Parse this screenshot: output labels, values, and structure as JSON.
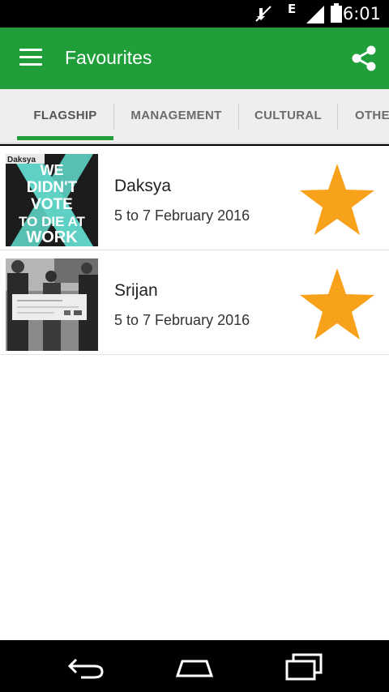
{
  "status_bar": {
    "time": "6:01",
    "network_type": "E",
    "icons": [
      "mute-icon",
      "signal-icon",
      "battery-icon"
    ]
  },
  "app_bar": {
    "title": "Favourites",
    "color": "#1f9e3a",
    "menu_icon": "hamburger-menu-icon",
    "action_icon": "share-icon"
  },
  "tabs": [
    {
      "label": "FLAGSHIP",
      "active": true
    },
    {
      "label": "MANAGEMENT",
      "active": false
    },
    {
      "label": "CULTURAL",
      "active": false
    },
    {
      "label": "OTHE",
      "active": false
    }
  ],
  "favourites": [
    {
      "name": "Daksya",
      "date": "5 to 7 February 2016",
      "favourite": true,
      "poster": {
        "corner_label": "Daksya",
        "lines": [
          "WE",
          "DIDN'T",
          "VOTE",
          "TO DIE AT",
          "WORK"
        ],
        "accent": "#5fd1c4"
      }
    },
    {
      "name": "Srijan",
      "date": "5 to 7 February 2016",
      "favourite": true,
      "poster": {
        "style": "grayscale-photo"
      }
    }
  ],
  "star_color": "#f8a21b",
  "nav_bar": {
    "buttons": [
      "back-icon",
      "home-icon",
      "recent-apps-icon"
    ]
  }
}
